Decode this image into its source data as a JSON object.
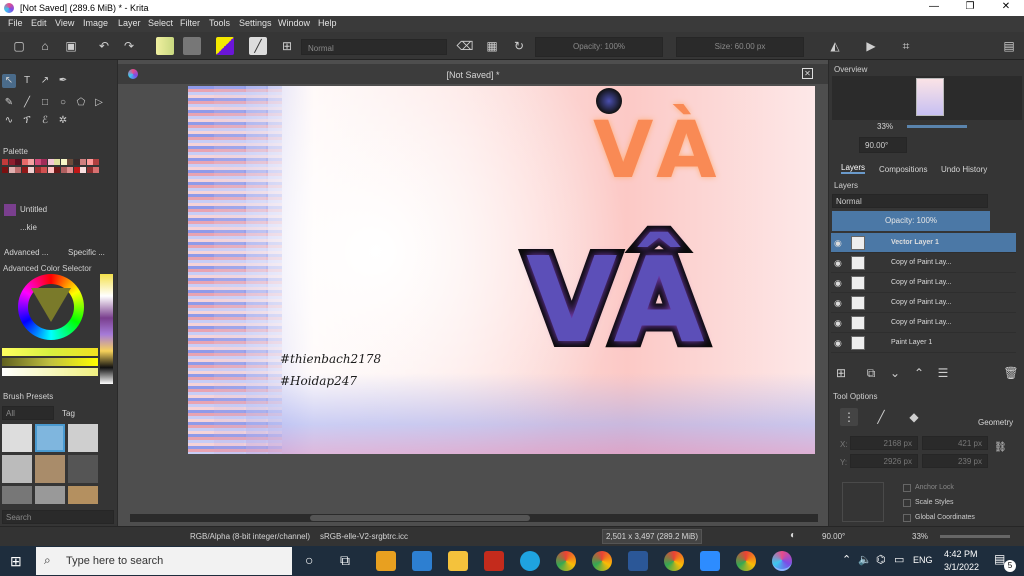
{
  "window": {
    "title": "[Not Saved]  (289.6 MiB)  * - Krita",
    "minimize": "—",
    "maximize": "❐",
    "close": "✕"
  },
  "menu": [
    "File",
    "Edit",
    "View",
    "Image",
    "Layer",
    "Select",
    "Filter",
    "Tools",
    "Settings",
    "Window",
    "Help"
  ],
  "toolbar": {
    "blend_mode": "Normal",
    "opacity": "Opacity: 100%",
    "size": "Size: 60.00 px"
  },
  "document": {
    "tab_title": "[Not Saved]  *"
  },
  "canvas": {
    "text_line1": "#thienbach2178",
    "text_line2": "#Hoidap247",
    "word1": "VÀ",
    "word2": "VÂ"
  },
  "left": {
    "palette_title": "Palette",
    "palette_name": "Untitled",
    "palette_entry": "...kie",
    "tab_advanced": "Advanced ...",
    "tab_specific": "Specific ...",
    "color_selector_title": "Advanced Color Selector",
    "brush_presets_title": "Brush Presets",
    "brush_filter": "All",
    "brush_tag": "Tag",
    "search_placeholder": "Search"
  },
  "right": {
    "overview_title": "Overview",
    "zoom": "33%",
    "rotation": "90.00°",
    "tabs": [
      "Layers",
      "Compositions",
      "Undo History"
    ],
    "layers_title": "Layers",
    "blend_mode": "Normal",
    "opacity": "Opacity:  100%",
    "layers": [
      {
        "name": "Vector Layer 1"
      },
      {
        "name": "Copy of Paint Lay..."
      },
      {
        "name": "Copy of Paint Lay..."
      },
      {
        "name": "Copy of Paint Lay..."
      },
      {
        "name": "Copy of Paint Lay..."
      },
      {
        "name": "Paint Layer 1"
      }
    ],
    "tool_options_title": "Tool Options",
    "geometry": "Geometry",
    "x_label": "X:",
    "y_label": "Y:",
    "x_value": "2168 px",
    "y_value": "2926 px",
    "w_value": "421 px",
    "h_value": "239 px",
    "anchor_lock": "Anchor Lock",
    "scale_styles": "Scale Styles",
    "global_coords": "Global Coordinates"
  },
  "status": {
    "color_space": "RGB/Alpha (8-bit integer/channel)",
    "profile": "sRGB-elle-V2-srgbtrc.icc",
    "dimensions": "2,501 x 3,497 (289.2 MiB)",
    "rotation": "90.00°",
    "zoom": "33%"
  },
  "taskbar": {
    "search_placeholder": "Type here to search",
    "time": "4:42 PM",
    "date": "3/1/2022",
    "lang": "ENG",
    "notif_count": "5"
  },
  "colors": {
    "accent": "#4a7fb0",
    "selected_layer": "#4b78a6",
    "canvas_text": "#1a1a1a"
  }
}
